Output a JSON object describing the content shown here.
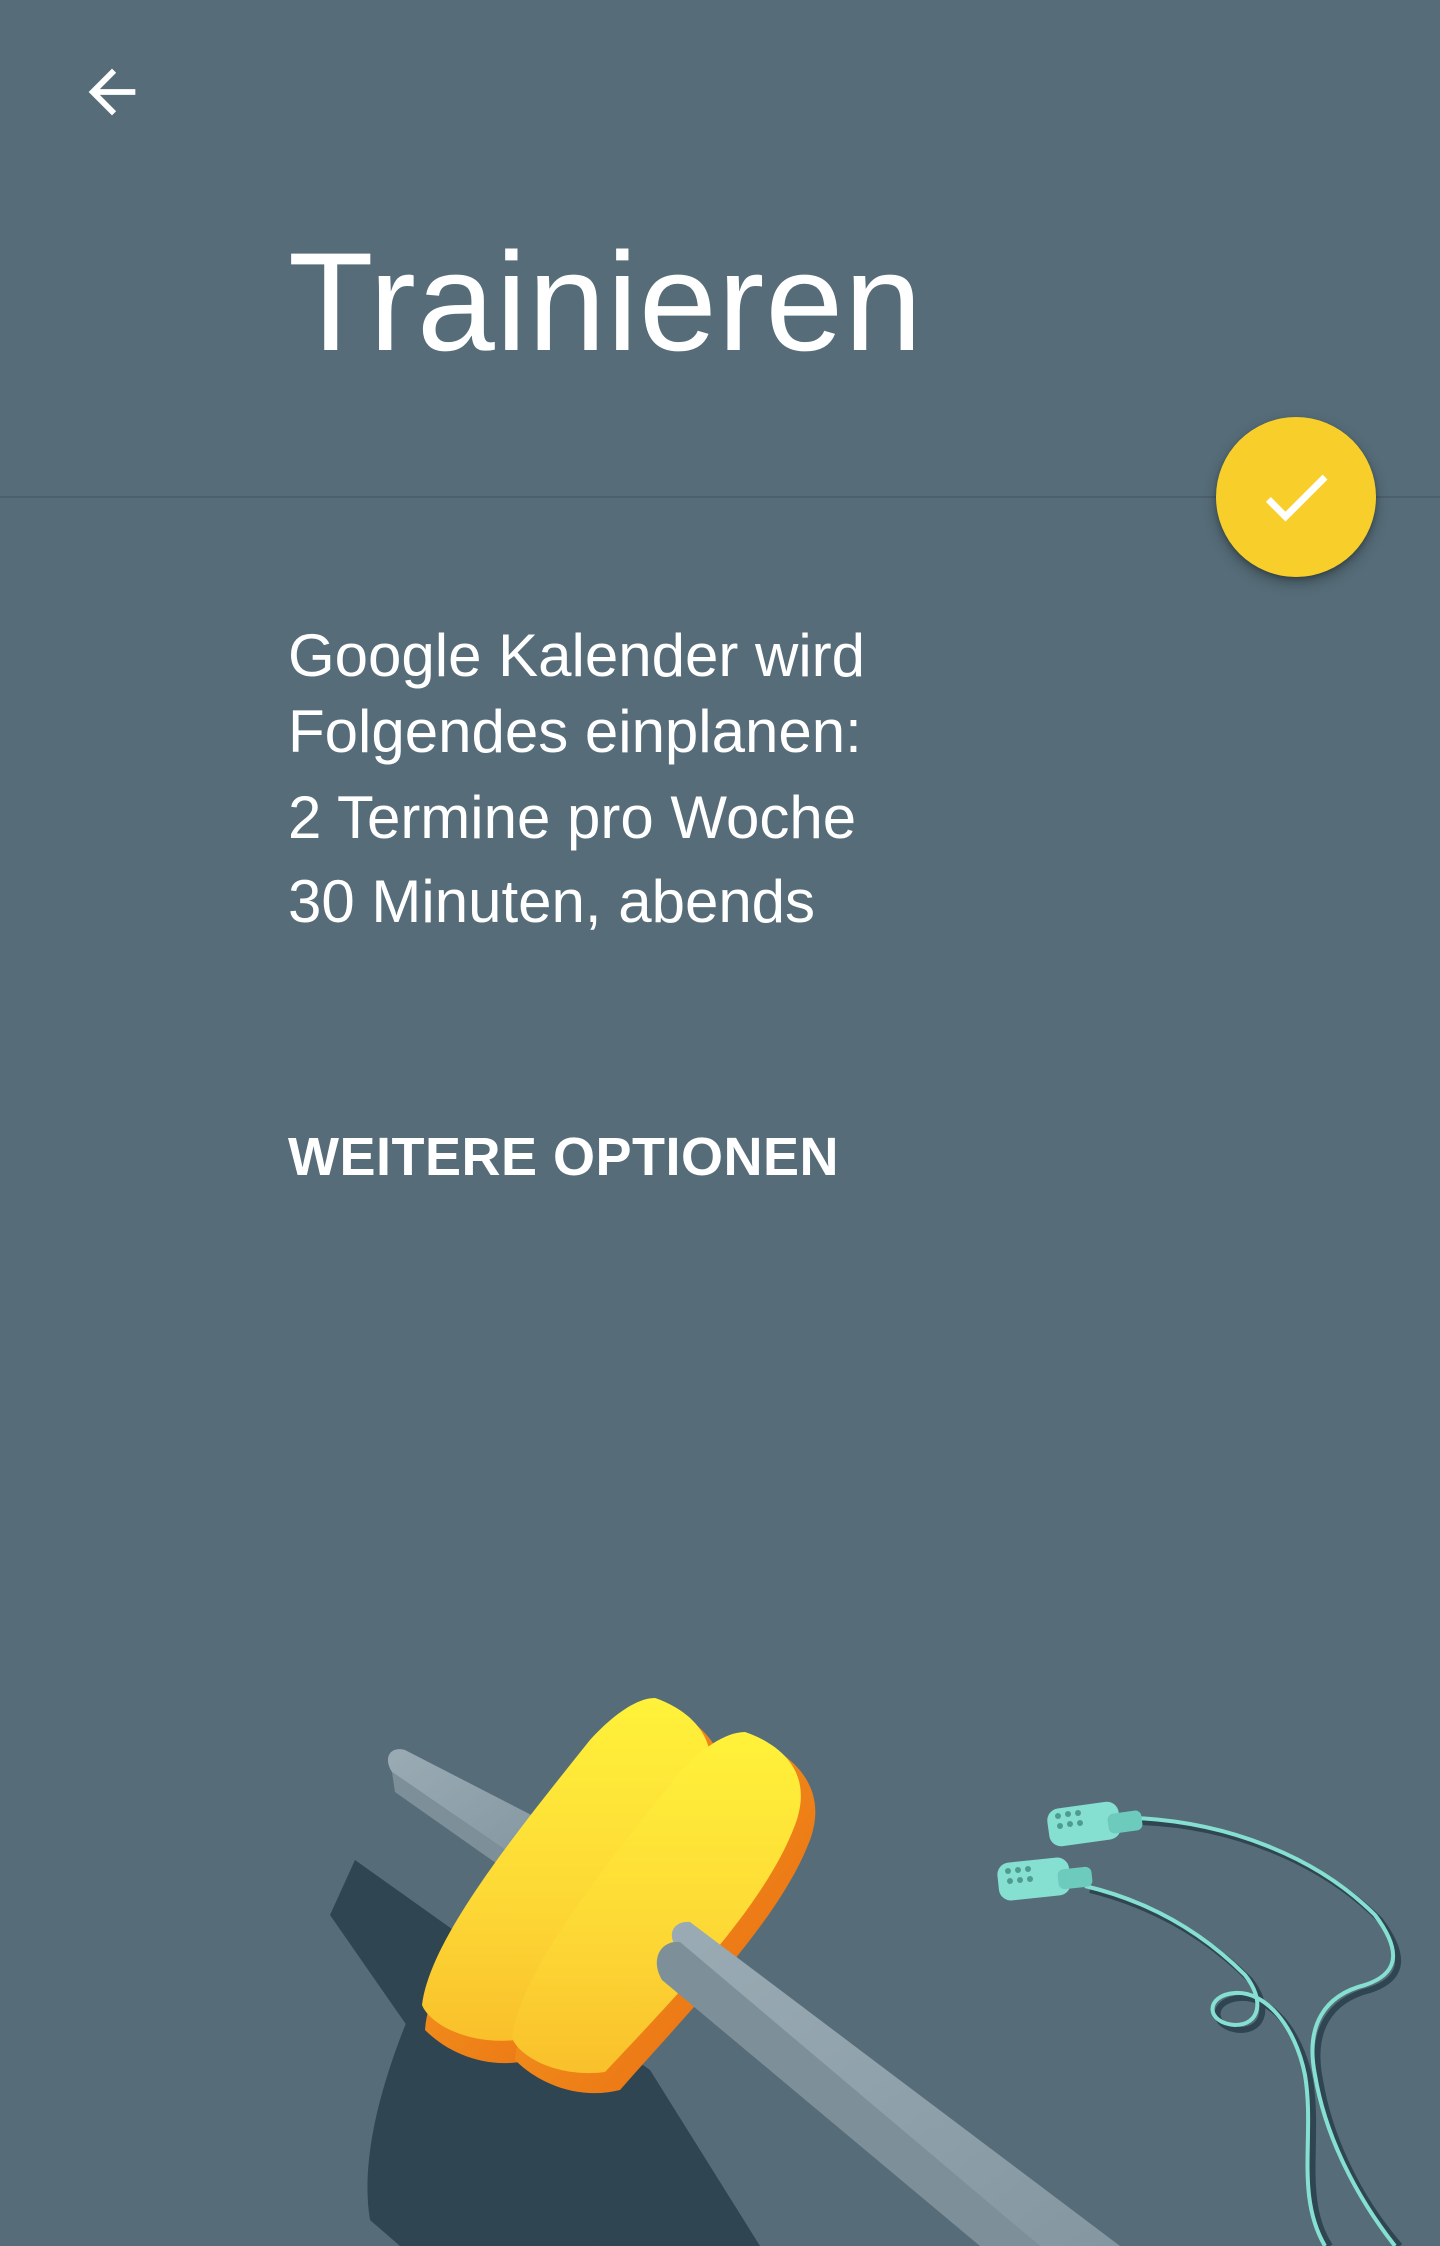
{
  "header": {
    "back_icon": "arrow-left-icon",
    "title": "Trainieren"
  },
  "fab": {
    "icon": "check-icon",
    "color": "#f8cf2a"
  },
  "summary": {
    "line1": "Google Kalender wird",
    "line2": "Folgendes einplanen:",
    "line3": "2 Termine pro Woche",
    "line4": "30 Minuten, abends"
  },
  "actions": {
    "more_options_label": "WEITERE OPTIONEN"
  },
  "illustration": {
    "subject": "dumbbell-and-earphones",
    "colors": {
      "background": "#566d79",
      "bar": "#8fa2ac",
      "weight_yellow": "#fdd835",
      "weight_orange": "#ef7f1a",
      "shadow": "#2f4551",
      "earphones": "#86e0d2"
    }
  }
}
